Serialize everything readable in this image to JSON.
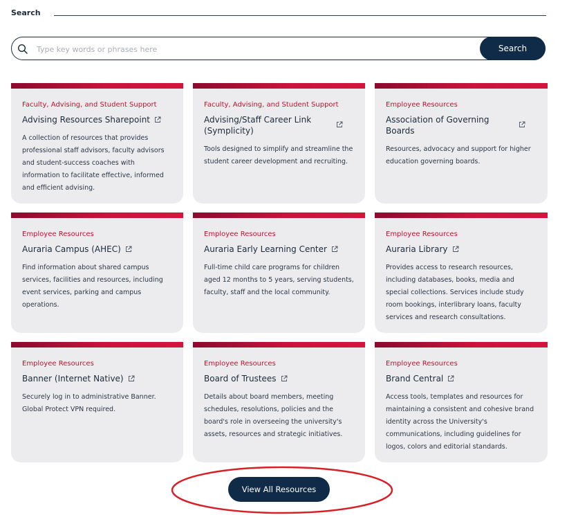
{
  "search": {
    "heading": "Search",
    "placeholder": "Type key words or phrases here",
    "button_label": "Search"
  },
  "cards": [
    {
      "category": "Faculty, Advising, and Student Support",
      "title": "Advising Resources Sharepoint",
      "description": "A collection of resources that provides professional staff advisors, faculty advisors and student-success coaches with information to facilitate effective, informed and efficient advising."
    },
    {
      "category": "Faculty, Advising, and Student Support",
      "title": "Advising/Staff Career Link (Symplicity)",
      "description": "Tools designed to simplify and streamline the student career development and recruiting."
    },
    {
      "category": "Employee Resources",
      "title": "Association of Governing Boards",
      "description": "Resources, advocacy and support for higher education governing boards."
    },
    {
      "category": "Employee Resources",
      "title": "Auraria Campus (AHEC)",
      "description": "Find information about shared campus services, facilities and resources, including event services, parking and campus operations."
    },
    {
      "category": "Employee Resources",
      "title": "Auraria Early Learning Center",
      "description": "Full-time child care programs for children aged 12 months to 5 years, serving students, faculty, staff and the local community."
    },
    {
      "category": "Employee Resources",
      "title": "Auraria Library",
      "description": "Provides access to research resources, including databases, books, media and special collections. Services include study room bookings, interlibrary loans, faculty services and research consultations."
    },
    {
      "category": "Employee Resources",
      "title": "Banner (Internet Native)",
      "description": "Securely log in to administrative Banner. Global Protect VPN required."
    },
    {
      "category": "Employee Resources",
      "title": "Board of Trustees",
      "description": "Details about board members, meeting schedules, resolutions, policies and the board's role in overseeing the university's assets, resources and strategic initiatives."
    },
    {
      "category": "Employee Resources",
      "title": "Brand Central",
      "description": "Access tools, templates and resources for maintaining a consistent and cohesive brand identity across the University's communications, including guidelines for logos, colors and editorial standards."
    }
  ],
  "view_all": {
    "label": "View All Resources"
  },
  "colors": {
    "accent_red": "#c4102f",
    "navy": "#0f2b47",
    "card_bg": "#ececee",
    "highlight_ring": "#d81f26"
  },
  "icons": {
    "search": "search-icon",
    "external": "external-link-icon"
  }
}
